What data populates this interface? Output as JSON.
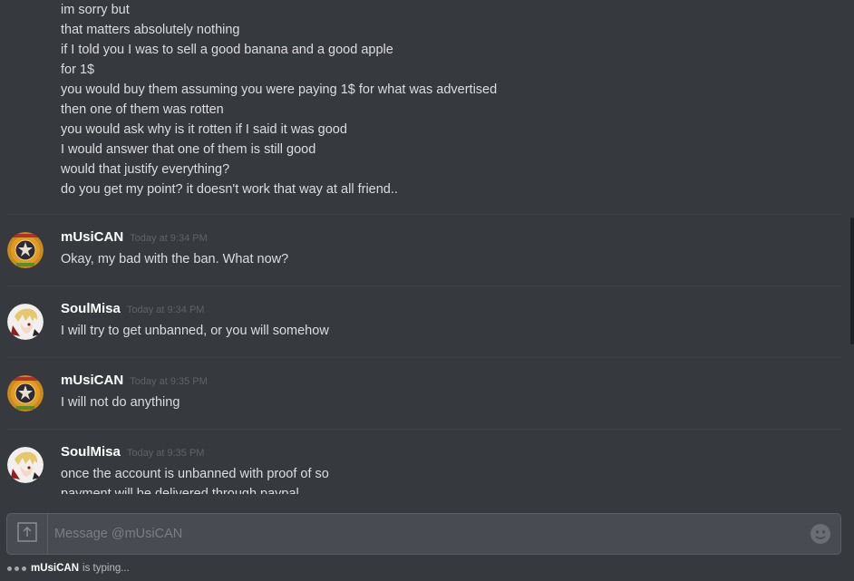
{
  "continued_lines": [
    "im sorry but",
    "that matters absolutely nothing",
    "if I told you I was to sell a good banana and a good apple",
    "for 1$",
    "you would buy them assuming you were paying 1$ for what was advertised",
    "then one of them was rotten",
    "you would ask why is it rotten if I said it was good",
    "I would answer that one of them is still good",
    "would that justify everything?",
    "do you get my point? it doesn't work that way at all friend.."
  ],
  "messages": [
    {
      "username": "mUsiCAN",
      "timestamp": "Today at 9:34 PM",
      "text": "Okay, my bad with the ban. What now?",
      "avatar": "emblem-avatar-icon"
    },
    {
      "username": "SoulMisa",
      "timestamp": "Today at 9:34 PM",
      "text": "I will try to get unbanned, or you will somehow",
      "avatar": "anime-avatar-icon"
    },
    {
      "username": "mUsiCAN",
      "timestamp": "Today at 9:35 PM",
      "text": "I will not do anything",
      "avatar": "emblem-avatar-icon"
    },
    {
      "username": "SoulMisa",
      "timestamp": "Today at 9:35 PM",
      "text": "once the account is unbanned with proof of so",
      "text2": "payment will be delivered through paypal",
      "avatar": "anime-avatar-icon"
    }
  ],
  "composer": {
    "placeholder": "Message @mUsiCAN",
    "upload_icon": "upload-icon",
    "emoji_icon": "emoji-icon"
  },
  "typing": {
    "user": "mUsiCAN",
    "suffix": "is typing..."
  },
  "colors": {
    "background": "#36393e",
    "composer": "#484b51",
    "username": "#ffffff",
    "text": "#dcddde",
    "timestamp": "#5f6369"
  }
}
